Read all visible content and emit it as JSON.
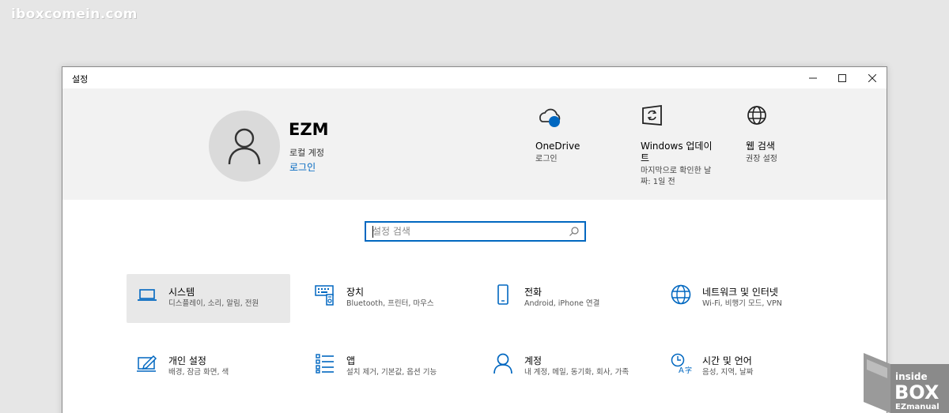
{
  "watermark": "iboxcomein.com",
  "window": {
    "title": "설정",
    "controls": {
      "minimize": "—",
      "maximize": "☐",
      "close": "✕"
    }
  },
  "account": {
    "name": "EZM",
    "type": "로컬 계정",
    "login_link": "로그인"
  },
  "header_items": [
    {
      "icon": "onedrive-icon",
      "title": "OneDrive",
      "desc": "로그인"
    },
    {
      "icon": "windows-update-icon",
      "title": "Windows 업데이트",
      "desc": "마지막으로 확인한 날짜: 1일 전"
    },
    {
      "icon": "globe-icon",
      "title": "웹 검색",
      "desc": "권장 설정"
    }
  ],
  "search": {
    "placeholder": "설정 검색"
  },
  "categories": [
    {
      "icon": "laptop-icon",
      "title": "시스템",
      "desc": "디스플레이, 소리, 알림, 전원"
    },
    {
      "icon": "keyboard-icon",
      "title": "장치",
      "desc": "Bluetooth, 프린터, 마우스"
    },
    {
      "icon": "phone-icon",
      "title": "전화",
      "desc": "Android, iPhone 연결"
    },
    {
      "icon": "network-icon",
      "title": "네트워크 및 인터넷",
      "desc": "Wi-Fi, 비행기 모드, VPN"
    },
    {
      "icon": "personalization-icon",
      "title": "개인 설정",
      "desc": "배경, 잠금 화면, 색"
    },
    {
      "icon": "apps-icon",
      "title": "앱",
      "desc": "설치 제거, 기본값, 옵션 기능"
    },
    {
      "icon": "account-icon",
      "title": "계정",
      "desc": "내 계정, 메일, 동기화, 회사, 가족"
    },
    {
      "icon": "time-language-icon",
      "title": "시간 및 언어",
      "desc": "음성, 지역, 날짜"
    }
  ],
  "brand_logo": {
    "line1": "inside",
    "line2": "BOX",
    "line3": "EZmanual"
  },
  "colors": {
    "accent": "#0067c0",
    "header_bg": "#f2f2f2",
    "selected_bg": "#e8e8e8"
  }
}
